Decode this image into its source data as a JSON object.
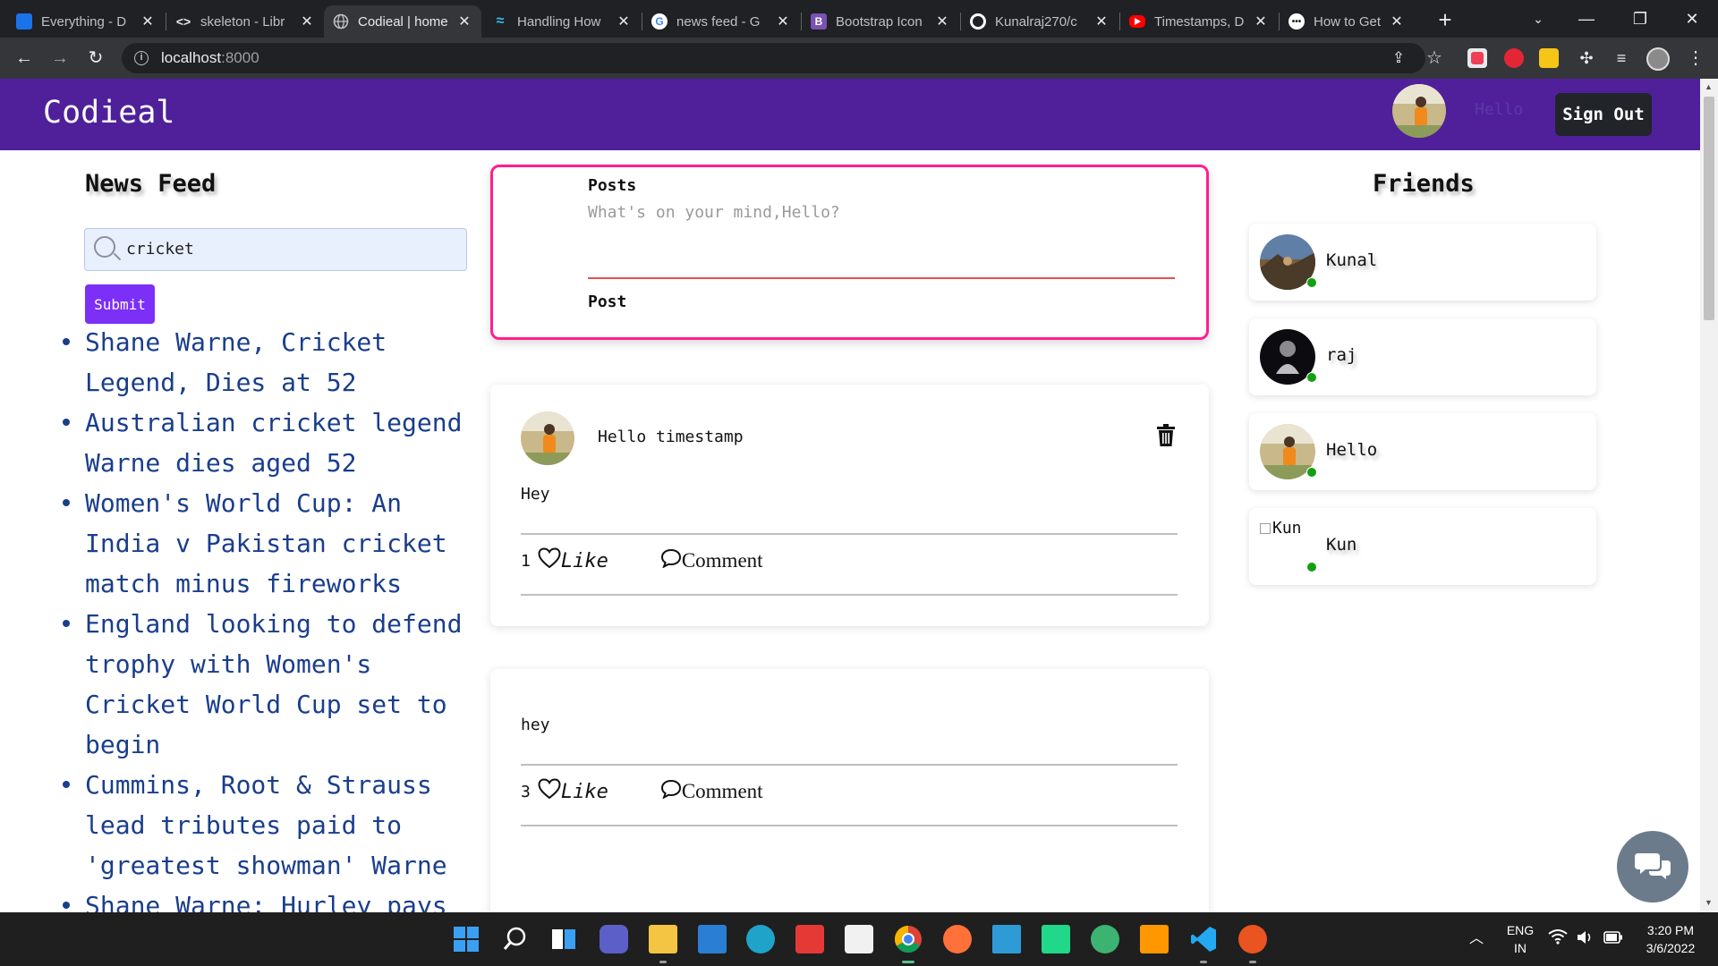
{
  "browser": {
    "tabs": [
      {
        "title": "Everything - D",
        "favicon": "dark-blue-square",
        "color": "#1a73e8"
      },
      {
        "title": "skeleton - Libr",
        "favicon": "code-brackets",
        "color": "#ffffff"
      },
      {
        "title": "Codieal | home",
        "favicon": "globe",
        "color": "#9aa0a6",
        "active": true
      },
      {
        "title": "Handling How",
        "favicon": "tailwind-wave",
        "color": "#38bdf8"
      },
      {
        "title": "news feed - G",
        "favicon": "google-g",
        "color": "#ffffff"
      },
      {
        "title": "Bootstrap Icon",
        "favicon": "bootstrap-b",
        "color": "#7952b3"
      },
      {
        "title": "Kunalraj270/c",
        "favicon": "github-cat",
        "color": "#ffffff"
      },
      {
        "title": "Timestamps, D",
        "favicon": "youtube-play",
        "color": "#ff0000"
      },
      {
        "title": "How to Get C",
        "favicon": "chat-bubble",
        "color": "#ffffff"
      }
    ],
    "address": {
      "host": "localhost",
      "port": ":8000"
    }
  },
  "navbar": {
    "brand": "Codieal",
    "username": "Hello",
    "signout_label": "Sign Out"
  },
  "left": {
    "title": "News Feed",
    "search_value": "cricket",
    "submit_label": "Submit",
    "news": [
      "Shane Warne, Cricket Legend, Dies at 52",
      "Australian cricket legend Warne dies aged 52",
      "Women's World Cup: An India v Pakistan cricket match minus fireworks",
      "England looking to defend trophy with Women's Cricket World Cup set to begin",
      "Cummins, Root & Strauss lead tributes paid to 'greatest showman' Warne",
      "Shane Warne: Hurley pays"
    ]
  },
  "composer": {
    "label": "Posts",
    "placeholder": "What's on your mind,Hello?",
    "post_label": "Post"
  },
  "posts": [
    {
      "author": "Hello timestamp",
      "content": "Hey",
      "likes": "1",
      "like_label": "Like",
      "comment_label": "Comment"
    },
    {
      "author": "",
      "content": "hey",
      "likes": "3",
      "like_label": "Like",
      "comment_label": "Comment"
    }
  ],
  "friends": {
    "title": "Friends",
    "list": [
      {
        "name": "Kunal",
        "avatar": "landscape-photo"
      },
      {
        "name": "raj",
        "avatar": "dark-photo"
      },
      {
        "name": "Hello",
        "avatar": "person-photo"
      },
      {
        "name": "Kun",
        "avatar": "broken-image",
        "alt": "Kun"
      }
    ]
  },
  "taskbar": {
    "lang_line1": "ENG",
    "lang_line2": "IN",
    "time": "3:20 PM",
    "date": "3/6/2022"
  },
  "colors": {
    "navbar": "#4f209a",
    "accent_pink": "#ff1f8e",
    "submit_purple": "#7b2ff7",
    "news_link": "#1a3e8c",
    "online_dot": "#12a012"
  }
}
